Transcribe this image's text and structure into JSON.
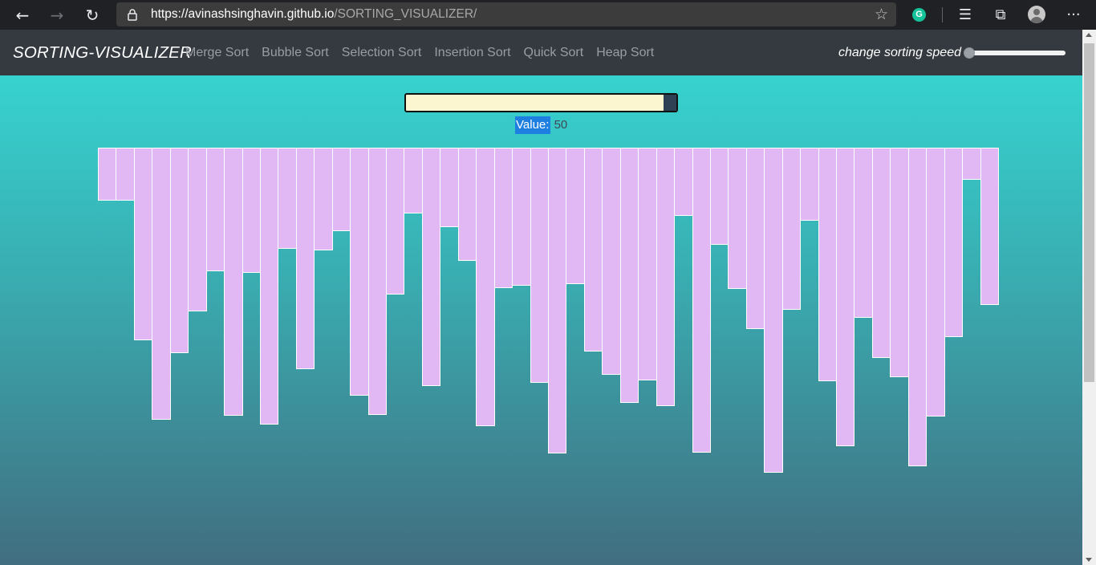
{
  "browser": {
    "url_host": "https://avinashsinghavin.github.io",
    "url_path": "/SORTING_VISUALIZER/",
    "grammarly_badge": "G",
    "more_label": "···"
  },
  "navbar": {
    "brand": "SORTING-VISUALIZER",
    "links": [
      "Merge Sort",
      "Bubble Sort",
      "Selection Sort",
      "Insertion Sort",
      "Quick Sort",
      "Heap Sort"
    ],
    "speed_label": "change sorting speed",
    "speed_value": 0
  },
  "array_size": {
    "label": "Value:",
    "value": "50"
  },
  "colors": {
    "bar": "#e1b8f4",
    "bar_border": "#ffffff",
    "navbar": "#343a40",
    "gradient_top": "#36dbd6",
    "gradient_bottom": "#416e80"
  },
  "chart_data": {
    "type": "bar",
    "values": [
      66,
      66,
      240,
      339,
      256,
      204,
      154,
      334,
      156,
      345,
      126,
      276,
      128,
      104,
      309,
      333,
      183,
      82,
      297,
      99,
      141,
      347,
      175,
      172,
      293,
      381,
      170,
      254,
      283,
      318,
      290,
      322,
      85,
      380,
      121,
      176,
      226,
      405,
      202,
      91,
      291,
      372,
      212,
      262,
      286,
      397,
      335,
      236,
      40,
      196
    ]
  }
}
